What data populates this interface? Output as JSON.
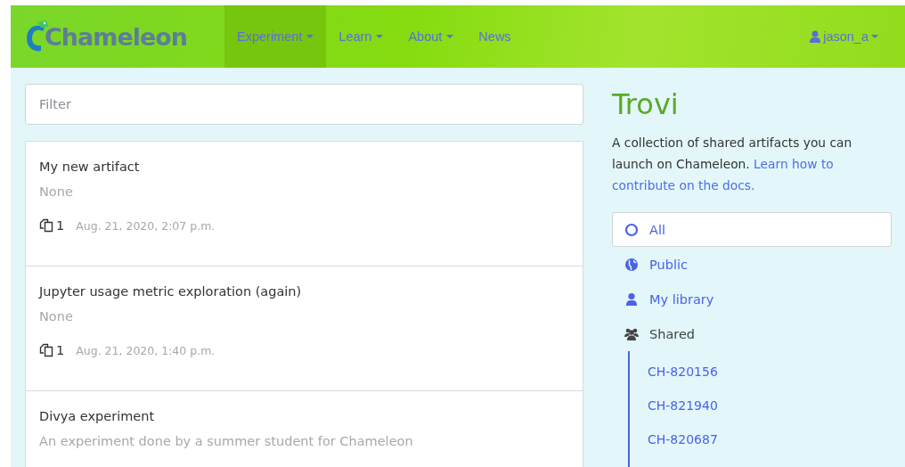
{
  "navbar": {
    "logo": "Chameleon",
    "items": [
      {
        "label": "Experiment",
        "dropdown": true,
        "selected": true
      },
      {
        "label": "Learn",
        "dropdown": true,
        "selected": false
      },
      {
        "label": "About",
        "dropdown": true,
        "selected": false
      },
      {
        "label": "News",
        "dropdown": false,
        "selected": false
      }
    ],
    "user": {
      "label": "jason_a",
      "dropdown": true
    }
  },
  "filter": {
    "placeholder": "Filter"
  },
  "artifacts": [
    {
      "title": "My new artifact",
      "description": "None",
      "versions": "1",
      "date": "Aug. 21, 2020, 2:07 p.m."
    },
    {
      "title": "Jupyter usage metric exploration (again)",
      "description": "None",
      "versions": "1",
      "date": "Aug. 21, 2020, 1:40 p.m."
    },
    {
      "title": "Divya experiment",
      "description": "An experiment done by a summer student for Chameleon"
    }
  ],
  "sidebar": {
    "title": "Trovi",
    "intro": "A collection of shared artifacts you can launch on Chameleon.",
    "intro_link": [
      "Learn how to",
      "contribute on the docs."
    ],
    "filters": [
      {
        "kind": "circle",
        "label": "All",
        "selected": true,
        "enabled": true
      },
      {
        "kind": "globe",
        "label": "Public",
        "selected": false,
        "enabled": true
      },
      {
        "kind": "user",
        "label": "My library",
        "selected": false,
        "enabled": true
      },
      {
        "kind": "users",
        "label": "Shared",
        "selected": false,
        "enabled": false,
        "children": [
          {
            "label": "CH-820156"
          },
          {
            "label": "CH-821940"
          },
          {
            "label": "CH-820687"
          }
        ]
      }
    ]
  }
}
